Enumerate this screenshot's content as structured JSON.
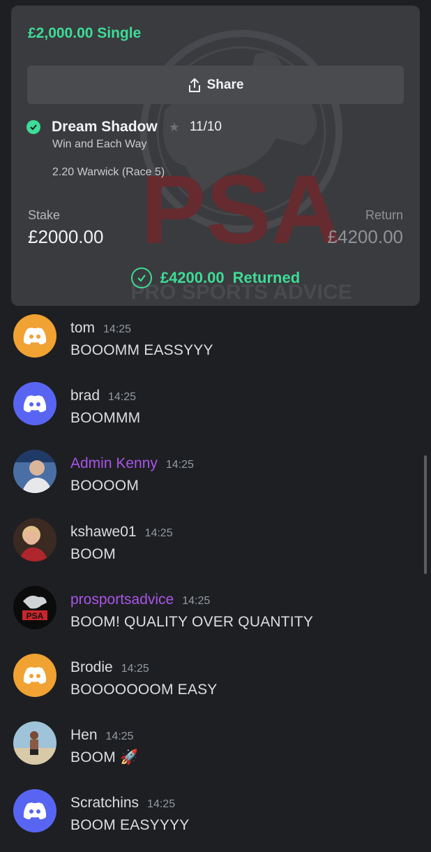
{
  "bet": {
    "title": "£2,000.00 Single",
    "share_label": "Share",
    "selection": "Dream Shadow",
    "odds": "11/10",
    "market": "Win and Each Way",
    "race": "2.20 Warwick (Race 5)",
    "stake_label": "Stake",
    "stake_value": "£2000.00",
    "return_label": "Return",
    "return_value": "£4200.00",
    "returned_amount": "£4200.00",
    "returned_label": "Returned",
    "accent_color": "#3ddc97"
  },
  "watermark": {
    "logo_text": "PSA",
    "tagline": "PRO SPORTS ADVICE"
  },
  "messages": [
    {
      "user": "tom",
      "time": "14:25",
      "text": "BOOOMM EASSYYY",
      "avatar": "discord-orange-icon",
      "role": "member"
    },
    {
      "user": "brad",
      "time": "14:25",
      "text": "BOOMMM",
      "avatar": "discord-blurple-icon",
      "role": "member"
    },
    {
      "user": "Admin Kenny",
      "time": "14:25",
      "text": "BOOOOM",
      "avatar": "photo-avatar",
      "role": "admin"
    },
    {
      "user": "kshawe01",
      "time": "14:25",
      "text": "BOOM",
      "avatar": "photo-avatar",
      "role": "member"
    },
    {
      "user": "prosportsadvice",
      "time": "14:25",
      "text": "BOOM! QUALITY OVER QUANTITY",
      "avatar": "psa-logo-avatar",
      "role": "admin"
    },
    {
      "user": "Brodie",
      "time": "14:25",
      "text": "BOOOOOOOM EASY",
      "avatar": "discord-orange-icon",
      "role": "member"
    },
    {
      "user": "Hen",
      "time": "14:25",
      "text": "BOOM 🚀",
      "avatar": "photo-avatar",
      "role": "member"
    },
    {
      "user": "Scratchins",
      "time": "14:25",
      "text": "BOOM EASYYYY",
      "avatar": "discord-blurple-icon",
      "role": "member"
    }
  ],
  "colors": {
    "background": "#1e1f22",
    "admin_name": "#a955e8",
    "discord_orange": "#f0a232",
    "discord_blurple": "#5865f2"
  }
}
